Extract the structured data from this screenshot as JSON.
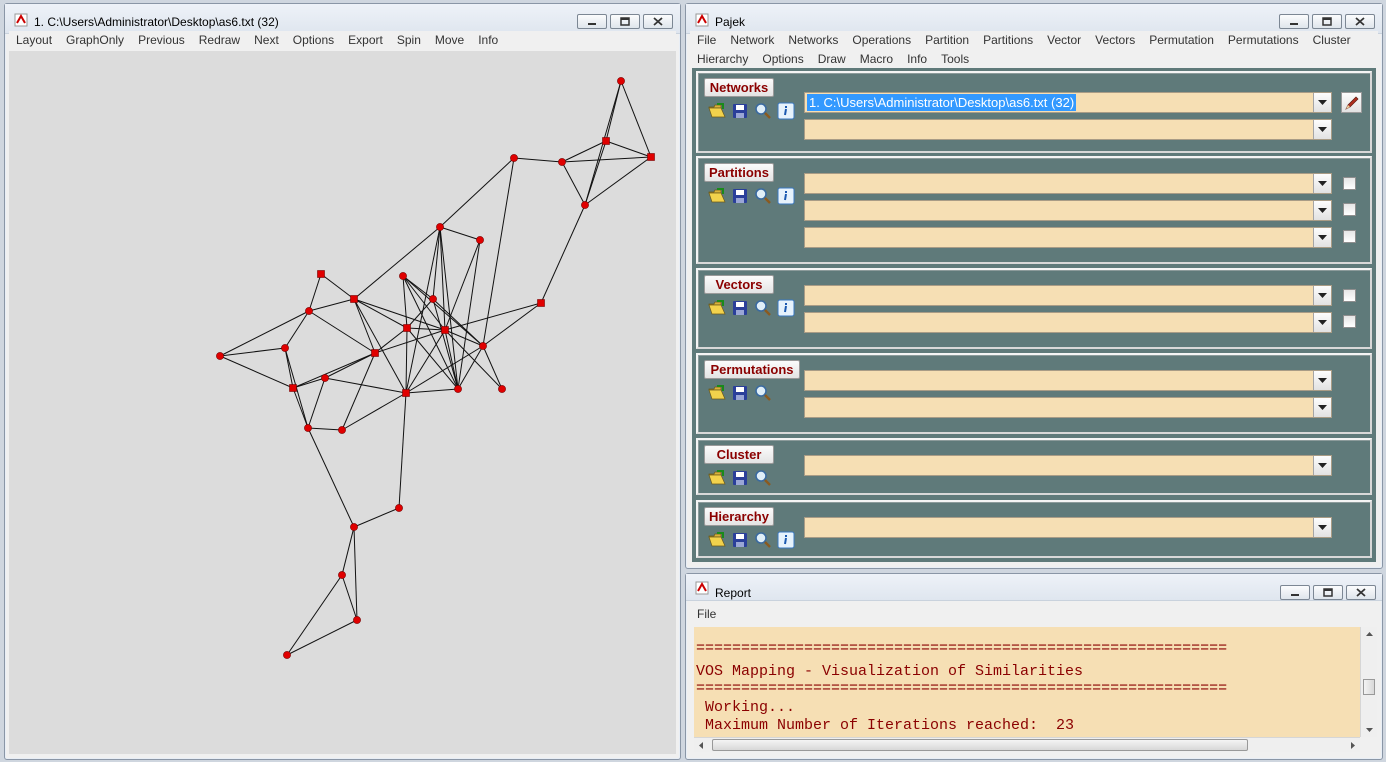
{
  "graph_window": {
    "title": "1. C:\\Users\\Administrator\\Desktop\\as6.txt (32)",
    "menu": [
      "Layout",
      "GraphOnly",
      "Previous",
      "Redraw",
      "Next",
      "Options",
      "Export",
      "Spin",
      "Move",
      "Info"
    ]
  },
  "main_window": {
    "title": "Pajek",
    "menu_row1": [
      "File",
      "Network",
      "Networks",
      "Operations",
      "Partition",
      "Partitions",
      "Vector",
      "Vectors",
      "Permutation",
      "Permutations",
      "Cluster"
    ],
    "menu_row2": [
      "Hierarchy",
      "Options",
      "Draw",
      "Macro",
      "Info",
      "Tools"
    ],
    "sections": {
      "networks": {
        "label": "Networks",
        "selected": "1. C:\\Users\\Administrator\\Desktop\\as6.txt (32)"
      },
      "partitions": {
        "label": "Partitions"
      },
      "vectors": {
        "label": "Vectors"
      },
      "permutations": {
        "label": "Permutations"
      },
      "cluster": {
        "label": "Cluster"
      },
      "hierarchy": {
        "label": "Hierarchy"
      }
    }
  },
  "report_window": {
    "title": "Report",
    "menu": [
      "File"
    ],
    "lines": [
      "===========================================================",
      "VOS Mapping - Visualization of Similarities",
      "===========================================================",
      " Working...",
      " Maximum Number of Iterations reached:  23"
    ]
  },
  "colors": {
    "panel": "#5f7a7a",
    "combo_fill": "#f6dfb4",
    "section_label": "#8b0000",
    "node": "#e00000",
    "selection": "#3399ff"
  },
  "icons": [
    "pajek-app-icon",
    "open-folder-icon",
    "save-disk-icon",
    "magnifier-icon",
    "info-icon",
    "edit-pencil-icon",
    "minimize-icon",
    "restore-icon",
    "close-icon"
  ]
}
